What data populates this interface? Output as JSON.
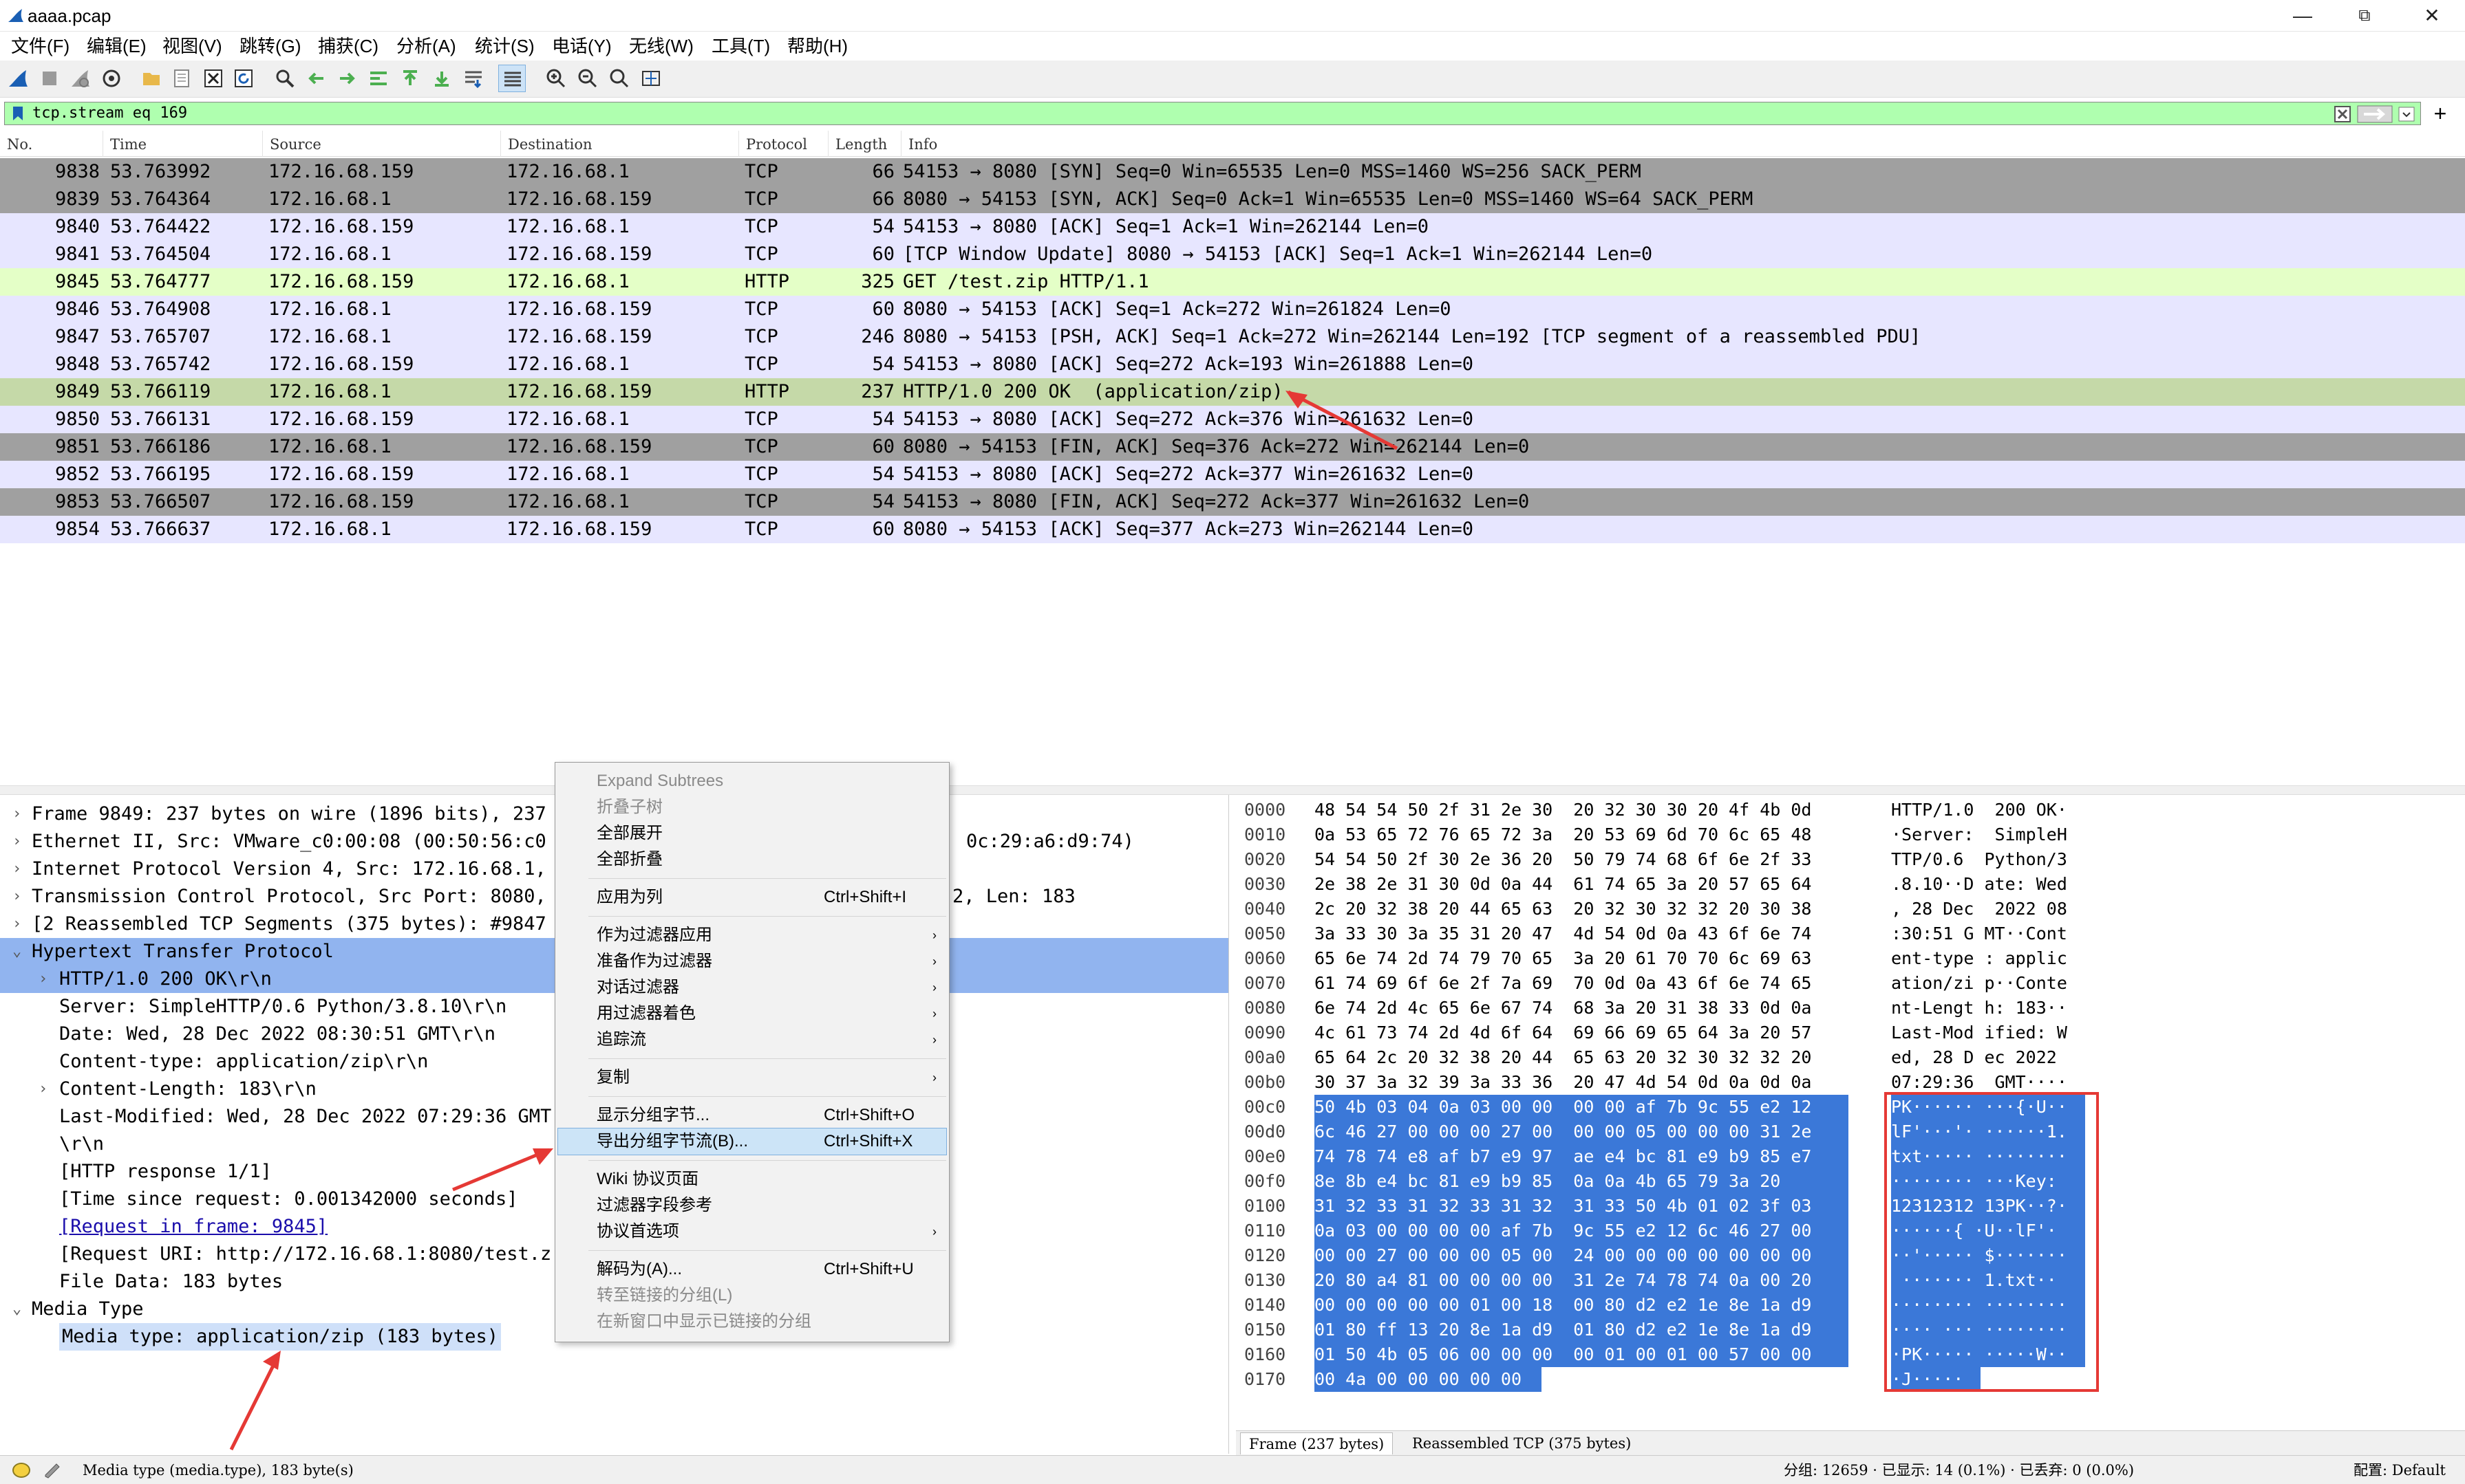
{
  "window": {
    "title": "aaaa.pcap",
    "minimize": "—",
    "maximize": "⧉",
    "close": "✕"
  },
  "menu": [
    "文件(F)",
    "编辑(E)",
    "视图(V)",
    "跳转(G)",
    "捕获(C)",
    "分析(A)",
    "统计(S)",
    "电话(Y)",
    "无线(W)",
    "工具(T)",
    "帮助(H)"
  ],
  "filter": {
    "value": "tcp.stream eq 169",
    "plus": "+"
  },
  "columns": [
    "No.",
    "Time",
    "Source",
    "Destination",
    "Protocol",
    "Length",
    "Info"
  ],
  "packets": [
    {
      "no": "9838",
      "time": "53.763992",
      "src": "172.16.68.159",
      "dst": "172.16.68.1",
      "proto": "TCP",
      "len": "66",
      "info": "54153 → 8080 [SYN] Seq=0 Win=65535 Len=0 MSS=1460 WS=256 SACK_PERM",
      "style": "dark"
    },
    {
      "no": "9839",
      "time": "53.764364",
      "src": "172.16.68.1",
      "dst": "172.16.68.159",
      "proto": "TCP",
      "len": "66",
      "info": "8080 → 54153 [SYN, ACK] Seq=0 Ack=1 Win=65535 Len=0 MSS=1460 WS=64 SACK_PERM",
      "style": "dark"
    },
    {
      "no": "9840",
      "time": "53.764422",
      "src": "172.16.68.159",
      "dst": "172.16.68.1",
      "proto": "TCP",
      "len": "54",
      "info": "54153 → 8080 [ACK] Seq=1 Ack=1 Win=262144 Len=0",
      "style": "tcp"
    },
    {
      "no": "9841",
      "time": "53.764504",
      "src": "172.16.68.1",
      "dst": "172.16.68.159",
      "proto": "TCP",
      "len": "60",
      "info": "[TCP Window Update] 8080 → 54153 [ACK] Seq=1 Ack=1 Win=262144 Len=0",
      "style": "tcp"
    },
    {
      "no": "9845",
      "time": "53.764777",
      "src": "172.16.68.159",
      "dst": "172.16.68.1",
      "proto": "HTTP",
      "len": "325",
      "info": "GET /test.zip HTTP/1.1",
      "style": "http"
    },
    {
      "no": "9846",
      "time": "53.764908",
      "src": "172.16.68.1",
      "dst": "172.16.68.159",
      "proto": "TCP",
      "len": "60",
      "info": "8080 → 54153 [ACK] Seq=1 Ack=272 Win=261824 Len=0",
      "style": "tcp"
    },
    {
      "no": "9847",
      "time": "53.765707",
      "src": "172.16.68.1",
      "dst": "172.16.68.159",
      "proto": "TCP",
      "len": "246",
      "info": "8080 → 54153 [PSH, ACK] Seq=1 Ack=272 Win=262144 Len=192 [TCP segment of a reassembled PDU]",
      "style": "tcp"
    },
    {
      "no": "9848",
      "time": "53.765742",
      "src": "172.16.68.159",
      "dst": "172.16.68.1",
      "proto": "TCP",
      "len": "54",
      "info": "54153 → 8080 [ACK] Seq=272 Ack=193 Win=261888 Len=0",
      "style": "tcp"
    },
    {
      "no": "9849",
      "time": "53.766119",
      "src": "172.16.68.1",
      "dst": "172.16.68.159",
      "proto": "HTTP",
      "len": "237",
      "info": "HTTP/1.0 200 OK  (application/zip)",
      "style": "selected"
    },
    {
      "no": "9850",
      "time": "53.766131",
      "src": "172.16.68.159",
      "dst": "172.16.68.1",
      "proto": "TCP",
      "len": "54",
      "info": "54153 → 8080 [ACK] Seq=272 Ack=376 Win=261632 Len=0",
      "style": "tcp"
    },
    {
      "no": "9851",
      "time": "53.766186",
      "src": "172.16.68.1",
      "dst": "172.16.68.159",
      "proto": "TCP",
      "len": "60",
      "info": "8080 → 54153 [FIN, ACK] Seq=376 Ack=272 Win=262144 Len=0",
      "style": "dark"
    },
    {
      "no": "9852",
      "time": "53.766195",
      "src": "172.16.68.159",
      "dst": "172.16.68.1",
      "proto": "TCP",
      "len": "54",
      "info": "54153 → 8080 [ACK] Seq=272 Ack=377 Win=261632 Len=0",
      "style": "tcp"
    },
    {
      "no": "9853",
      "time": "53.766507",
      "src": "172.16.68.159",
      "dst": "172.16.68.1",
      "proto": "TCP",
      "len": "54",
      "info": "54153 → 8080 [FIN, ACK] Seq=272 Ack=377 Win=261632 Len=0",
      "style": "dark"
    },
    {
      "no": "9854",
      "time": "53.766637",
      "src": "172.16.68.1",
      "dst": "172.16.68.159",
      "proto": "TCP",
      "len": "60",
      "info": "8080 → 54153 [ACK] Seq=377 Ack=273 Win=262144 Len=0",
      "style": "tcp"
    }
  ],
  "details": [
    {
      "indent": 0,
      "arrow": "›",
      "text": "Frame 9849: 237 bytes on wire (1896 bits), 237",
      "style": ""
    },
    {
      "indent": 0,
      "arrow": "›",
      "text": "Ethernet II, Src: VMware_c0:00:08 (00:50:56:c0",
      "tail": "0c:29:a6:d9:74)",
      "style": ""
    },
    {
      "indent": 0,
      "arrow": "›",
      "text": "Internet Protocol Version 4, Src: 172.16.68.1,",
      "style": ""
    },
    {
      "indent": 0,
      "arrow": "›",
      "text": "Transmission Control Protocol, Src Port: 8080,",
      "tail": "2, Len: 183",
      "style": ""
    },
    {
      "indent": 0,
      "arrow": "›",
      "text": "[2 Reassembled TCP Segments (375 bytes): #9847",
      "style": ""
    },
    {
      "indent": 0,
      "arrow": "⌄",
      "text": "Hypertext Transfer Protocol",
      "style": "sel"
    },
    {
      "indent": 1,
      "arrow": "›",
      "text": "HTTP/1.0 200 OK\\r\\n",
      "style": "sel"
    },
    {
      "indent": 1,
      "arrow": "",
      "text": "Server: SimpleHTTP/0.6 Python/3.8.10\\r\\n",
      "style": ""
    },
    {
      "indent": 1,
      "arrow": "",
      "text": "Date: Wed, 28 Dec 2022 08:30:51 GMT\\r\\n",
      "style": ""
    },
    {
      "indent": 1,
      "arrow": "",
      "text": "Content-type: application/zip\\r\\n",
      "style": ""
    },
    {
      "indent": 1,
      "arrow": "›",
      "text": "Content-Length: 183\\r\\n",
      "style": ""
    },
    {
      "indent": 1,
      "arrow": "",
      "text": "Last-Modified: Wed, 28 Dec 2022 07:29:36 GMT",
      "style": ""
    },
    {
      "indent": 1,
      "arrow": "",
      "text": "\\r\\n",
      "style": ""
    },
    {
      "indent": 1,
      "arrow": "",
      "text": "[HTTP response 1/1]",
      "style": ""
    },
    {
      "indent": 1,
      "arrow": "",
      "text": "[Time since request: 0.001342000 seconds]",
      "style": ""
    },
    {
      "indent": 1,
      "arrow": "",
      "text": "[Request in frame: 9845]",
      "style": "link"
    },
    {
      "indent": 1,
      "arrow": "",
      "text": "[Request URI: http://172.16.68.1:8080/test.z",
      "style": ""
    },
    {
      "indent": 1,
      "arrow": "",
      "text": "File Data: 183 bytes",
      "style": ""
    },
    {
      "indent": 0,
      "arrow": "⌄",
      "text": "Media Type",
      "style": ""
    },
    {
      "indent": 1,
      "arrow": "",
      "text": "Media type: application/zip (183 bytes)",
      "style": "sel2"
    }
  ],
  "context_menu": [
    {
      "label": "Expand Subtrees",
      "shortcut": "",
      "disabled": true,
      "sub": false
    },
    {
      "label": "折叠子树",
      "shortcut": "",
      "disabled": true,
      "sub": false
    },
    {
      "label": "全部展开",
      "shortcut": "",
      "disabled": false,
      "sub": false
    },
    {
      "label": "全部折叠",
      "shortcut": "",
      "disabled": false,
      "sub": false,
      "sep_after": true
    },
    {
      "label": "应用为列",
      "shortcut": "Ctrl+Shift+I",
      "disabled": false,
      "sub": false,
      "sep_after": true
    },
    {
      "label": "作为过滤器应用",
      "shortcut": "",
      "disabled": false,
      "sub": true
    },
    {
      "label": "准备作为过滤器",
      "shortcut": "",
      "disabled": false,
      "sub": true
    },
    {
      "label": "对话过滤器",
      "shortcut": "",
      "disabled": false,
      "sub": true
    },
    {
      "label": "用过滤器着色",
      "shortcut": "",
      "disabled": false,
      "sub": true
    },
    {
      "label": "追踪流",
      "shortcut": "",
      "disabled": false,
      "sub": true,
      "sep_after": true
    },
    {
      "label": "复制",
      "shortcut": "",
      "disabled": false,
      "sub": true,
      "sep_after": true
    },
    {
      "label": "显示分组字节...",
      "shortcut": "Ctrl+Shift+O",
      "disabled": false,
      "sub": false
    },
    {
      "label": "导出分组字节流(B)...",
      "shortcut": "Ctrl+Shift+X",
      "disabled": false,
      "sub": false,
      "highlight": true,
      "sep_after": true
    },
    {
      "label": "Wiki 协议页面",
      "shortcut": "",
      "disabled": false,
      "sub": false
    },
    {
      "label": "过滤器字段参考",
      "shortcut": "",
      "disabled": false,
      "sub": false
    },
    {
      "label": "协议首选项",
      "shortcut": "",
      "disabled": false,
      "sub": true,
      "sep_after": true
    },
    {
      "label": "解码为(A)...",
      "shortcut": "Ctrl+Shift+U",
      "disabled": false,
      "sub": false
    },
    {
      "label": "转至链接的分组(L)",
      "shortcut": "",
      "disabled": true,
      "sub": false
    },
    {
      "label": "在新窗口中显示已链接的分组",
      "shortcut": "",
      "disabled": true,
      "sub": false
    }
  ],
  "bytes": [
    {
      "off": "0000",
      "hex": "48 54 54 50 2f 31 2e 30  20 32 30 30 20 4f 4b 0d",
      "ascii": "HTTP/1.0  200 OK·"
    },
    {
      "off": "0010",
      "hex": "0a 53 65 72 76 65 72 3a  20 53 69 6d 70 6c 65 48",
      "ascii": "·Server:  SimpleH"
    },
    {
      "off": "0020",
      "hex": "54 54 50 2f 30 2e 36 20  50 79 74 68 6f 6e 2f 33",
      "ascii": "TTP/0.6  Python/3"
    },
    {
      "off": "0030",
      "hex": "2e 38 2e 31 30 0d 0a 44  61 74 65 3a 20 57 65 64",
      "ascii": ".8.10··D ate: Wed"
    },
    {
      "off": "0040",
      "hex": "2c 20 32 38 20 44 65 63  20 32 30 32 32 20 30 38",
      "ascii": ", 28 Dec  2022 08"
    },
    {
      "off": "0050",
      "hex": "3a 33 30 3a 35 31 20 47  4d 54 0d 0a 43 6f 6e 74",
      "ascii": ":30:51 G MT··Cont"
    },
    {
      "off": "0060",
      "hex": "65 6e 74 2d 74 79 70 65  3a 20 61 70 70 6c 69 63",
      "ascii": "ent-type : applic"
    },
    {
      "off": "0070",
      "hex": "61 74 69 6f 6e 2f 7a 69  70 0d 0a 43 6f 6e 74 65",
      "ascii": "ation/zi p··Conte"
    },
    {
      "off": "0080",
      "hex": "6e 74 2d 4c 65 6e 67 74  68 3a 20 31 38 33 0d 0a",
      "ascii": "nt-Lengt h: 183··"
    },
    {
      "off": "0090",
      "hex": "4c 61 73 74 2d 4d 6f 64  69 66 69 65 64 3a 20 57",
      "ascii": "Last-Mod ified: W"
    },
    {
      "off": "00a0",
      "hex": "65 64 2c 20 32 38 20 44  65 63 20 32 30 32 32 20",
      "ascii": "ed, 28 D ec 2022 "
    },
    {
      "off": "00b0",
      "hex": "30 37 3a 32 39 3a 33 36  20 47 4d 54 0d 0a 0d 0a",
      "ascii": "07:29:36  GMT····"
    },
    {
      "off": "00c0",
      "hex": "50 4b 03 04 0a 03 00 00  00 00 af 7b 9c 55 e2 12",
      "ascii": "PK······ ···{·U··"
    },
    {
      "off": "00d0",
      "hex": "6c 46 27 00 00 00 27 00  00 00 05 00 00 00 31 2e",
      "ascii": "lF'···'· ······1."
    },
    {
      "off": "00e0",
      "hex": "74 78 74 e8 af b7 e9 97  ae e4 bc 81 e9 b9 85 e7",
      "ascii": "txt····· ········"
    },
    {
      "off": "00f0",
      "hex": "8e 8b e4 bc 81 e9 b9 85  0a 0a 4b 65 79 3a 20",
      "ascii": "········ ···Key: "
    },
    {
      "off": "0100",
      "hex": "31 32 33 31 32 33 31 32  31 33 50 4b 01 02 3f 03",
      "ascii": "12312312 13PK··?·"
    },
    {
      "off": "0110",
      "hex": "0a 03 00 00 00 00 af 7b  9c 55 e2 12 6c 46 27 00",
      "ascii": "······{ ·U··lF'·"
    },
    {
      "off": "0120",
      "hex": "00 00 27 00 00 00 05 00  24 00 00 00 00 00 00 00",
      "ascii": "··'····· $·······"
    },
    {
      "off": "0130",
      "hex": "20 80 a4 81 00 00 00 00  31 2e 74 78 74 0a 00 20",
      "ascii": " ······· 1.txt·· "
    },
    {
      "off": "0140",
      "hex": "00 00 00 00 00 01 00 18  00 80 d2 e2 1e 8e 1a d9",
      "ascii": "········ ········"
    },
    {
      "off": "0150",
      "hex": "01 80 ff 13 20 8e 1a d9  01 80 d2 e2 1e 8e 1a d9",
      "ascii": "···· ··· ········"
    },
    {
      "off": "0160",
      "hex": "01 50 4b 05 06 00 00 00  00 01 00 01 00 57 00 00",
      "ascii": "·PK····· ·····W··"
    },
    {
      "off": "0170",
      "hex": "00 4a 00 00 00 00 00",
      "ascii": "·J·····"
    }
  ],
  "bytes_tabs": [
    "Frame (237 bytes)",
    "Reassembled TCP (375 bytes)"
  ],
  "status": {
    "field": "Media type (media.type), 183 byte(s)",
    "packets": "分组: 12659 · 已显示: 14 (0.1%) · 已丢弃: 0 (0.0%)",
    "profile": "配置: Default"
  },
  "colors": {
    "tcp": "#e7e6ff",
    "http": "#e4ffc7",
    "dark": "#a0a0a0",
    "selected": "#c5d9a8",
    "tree_sel": "#91b4ef",
    "tree_sel2": "#cfe0f9",
    "hex_sel": "#3b78d8",
    "annotation": "#e53935"
  }
}
